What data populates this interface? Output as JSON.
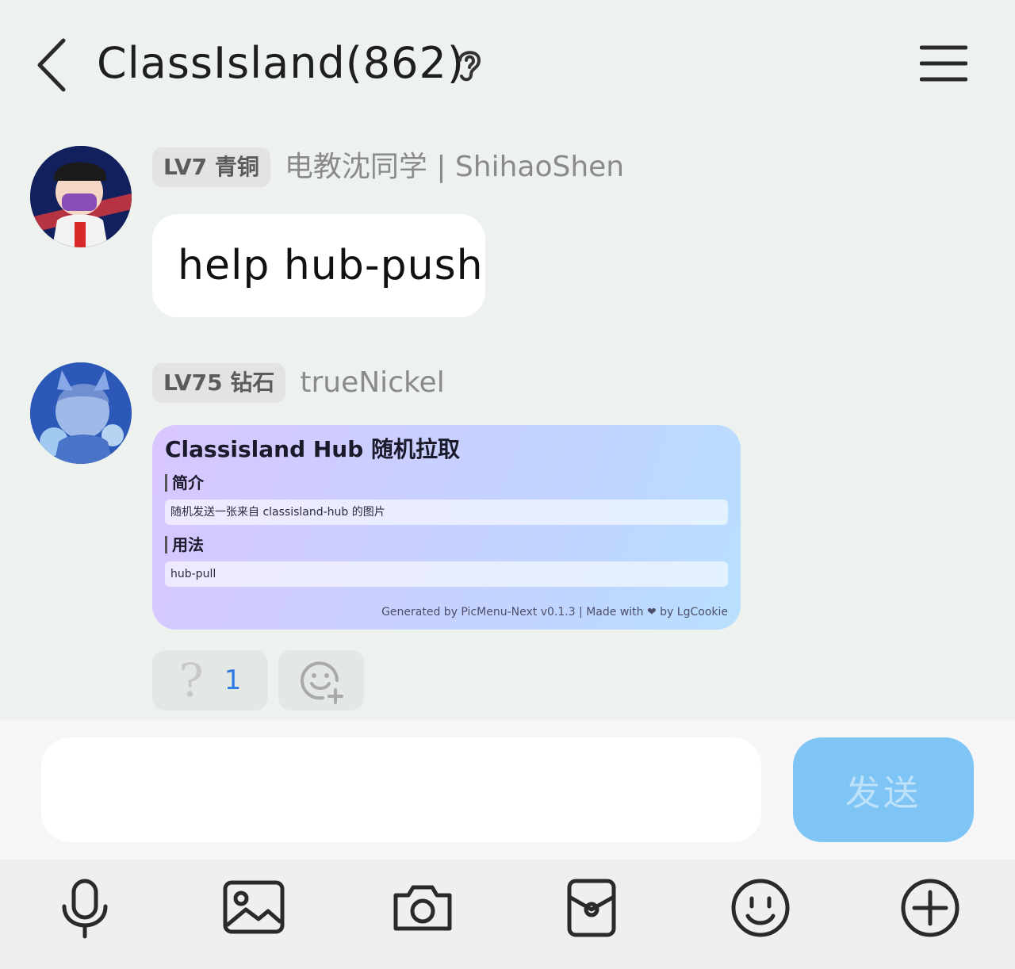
{
  "header": {
    "title": "ClassIsland(862)"
  },
  "messages": [
    {
      "level": "LV7 青铜",
      "sender": "电教沈同学 | ShihaoShen",
      "text": "help hub-push"
    },
    {
      "level": "LV75 钻石",
      "sender": "trueNickel",
      "card": {
        "title": "Classisland Hub 随机拉取",
        "section1_title": "简介",
        "section1_text": "随机发送一张来自 classisland-hub 的图片",
        "section2_title": "用法",
        "section2_text": "hub-pull",
        "footer": "Generated by PicMenu-Next v0.1.3 | Made with ❤ by LgCookie"
      },
      "reactions": [
        {
          "emoji": "?",
          "count": "1"
        }
      ]
    }
  ],
  "composer": {
    "placeholder": "",
    "send_label": "发送"
  },
  "toolbar": {
    "items": [
      "mic-icon",
      "image-icon",
      "camera-icon",
      "red-packet-icon",
      "emoji-icon",
      "plus-icon"
    ]
  },
  "colors": {
    "background": "#eef2ee",
    "send_button": "#7ec4f5",
    "reaction_count": "#2f7be6"
  }
}
